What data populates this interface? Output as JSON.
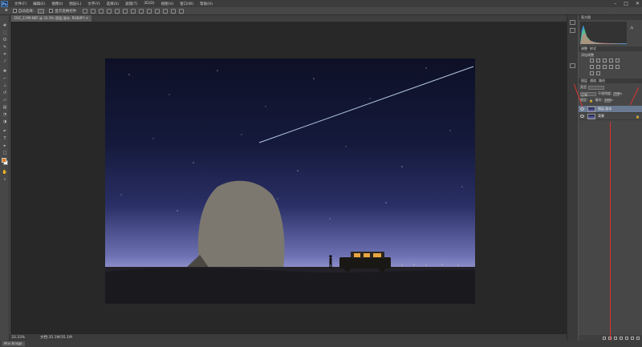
{
  "app": {
    "logo": "Ps"
  },
  "menu": [
    "文件(F)",
    "编辑(E)",
    "图像(I)",
    "图层(L)",
    "文字(Y)",
    "选择(S)",
    "滤镜(T)",
    "3D(D)",
    "视图(V)",
    "窗口(W)",
    "帮助(H)"
  ],
  "window_controls": {
    "minimize": "–",
    "maximize": "□",
    "close": "✕"
  },
  "options_bar": {
    "sample_label": "自动选择：",
    "show_transform": "显示变换控件",
    "workspace": "基本功能"
  },
  "document": {
    "tab": "DSC_1199.NEF @ 33.3% (图层 副本, RGB/8*) ✕"
  },
  "status": {
    "zoom": "33.33%",
    "info": "文档:35.1M/35.1M"
  },
  "mini_bridge": "Mini Bridge",
  "panels": {
    "histogram_tab": "直方图",
    "adjust_tabs": [
      "调整",
      "样式"
    ],
    "adjust_label": "添加调整",
    "layers_tabs": [
      "图层",
      "通道",
      "路径"
    ],
    "kind_label": "类型",
    "blend_mode": "正常",
    "opacity_label": "不透明度:",
    "opacity_value": "100%",
    "lock_label": "锁定:",
    "fill_label": "填充:",
    "fill_value": "100%",
    "layers": [
      {
        "name": "图层 副本",
        "active": true
      },
      {
        "name": "背景",
        "active": false
      }
    ]
  },
  "icons": {
    "tools": [
      "move-icon",
      "marquee-icon",
      "lasso-icon",
      "quick-select-icon",
      "crop-icon",
      "eyedropper-icon",
      "healing-icon",
      "brush-icon",
      "stamp-icon",
      "history-brush-icon",
      "eraser-icon",
      "gradient-icon",
      "blur-icon",
      "dodge-icon",
      "pen-icon",
      "type-icon",
      "path-select-icon",
      "shape-icon",
      "hand-icon",
      "zoom-icon"
    ]
  },
  "colors": {
    "foreground": "#e0781f",
    "background": "#ffffff",
    "accent": "#6a7a92"
  }
}
